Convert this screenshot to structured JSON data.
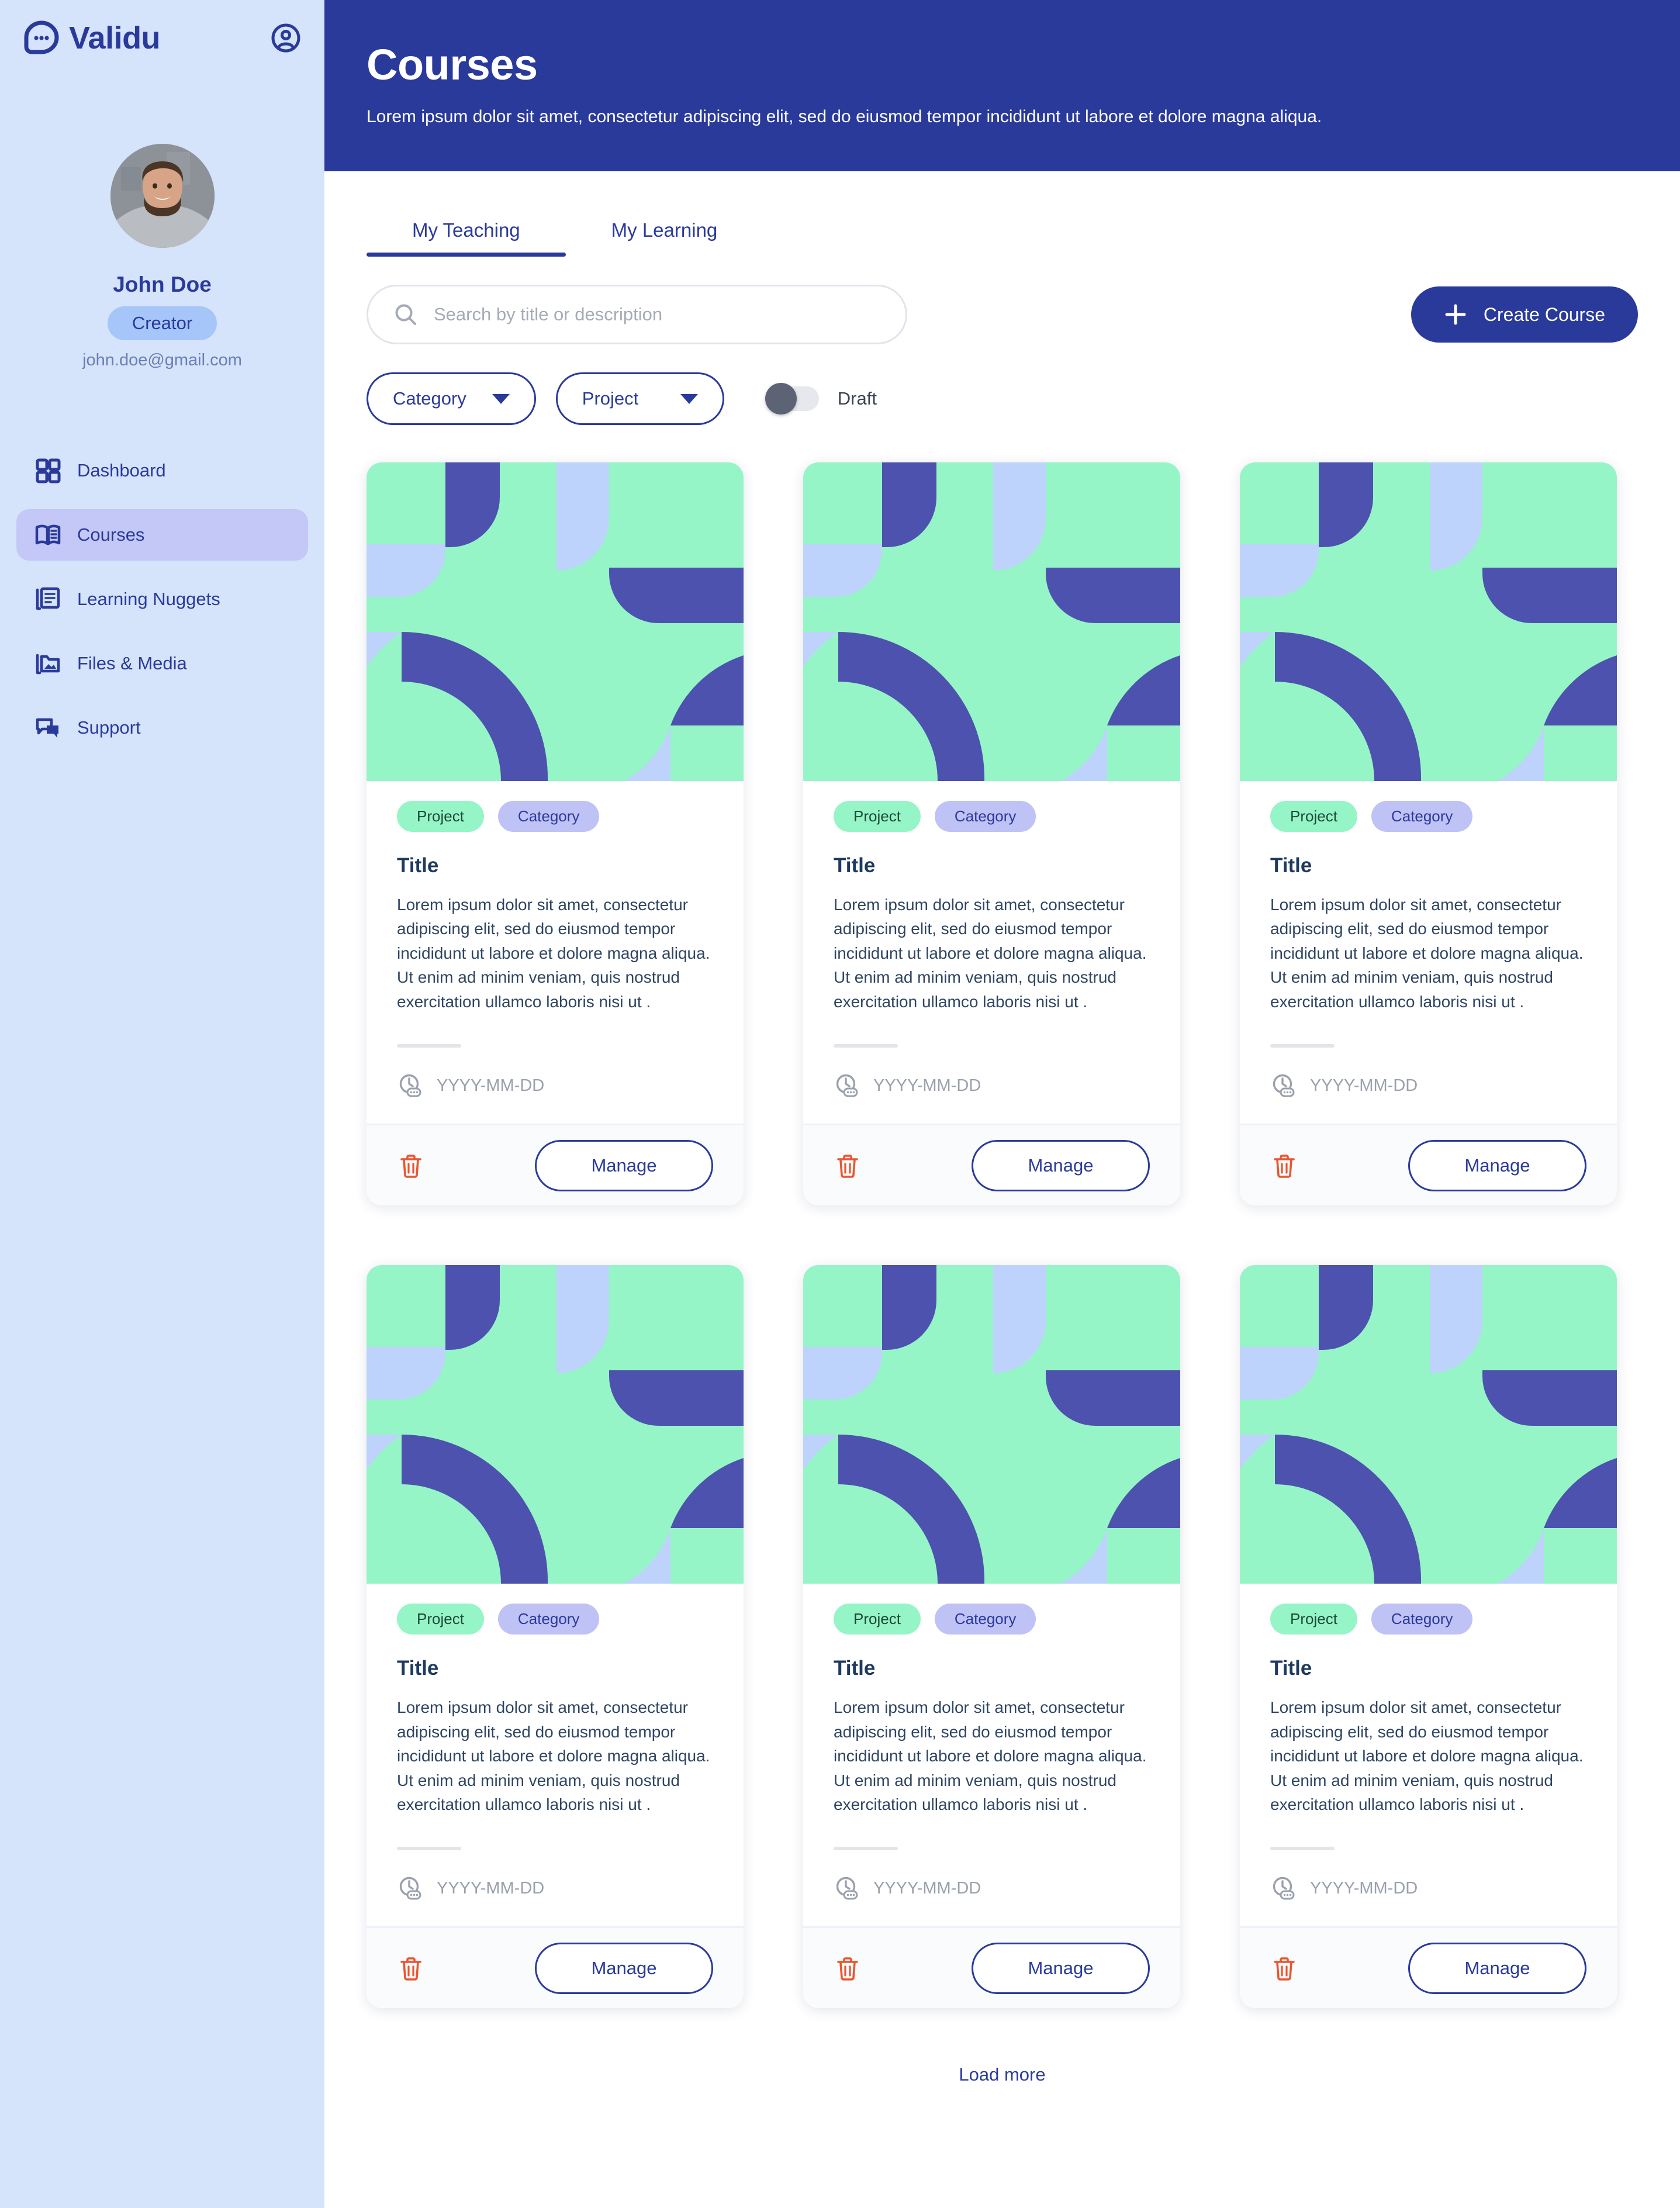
{
  "brand": {
    "name": "Validu",
    "logo_icon": "chat-bubble-dots-icon",
    "account_icon": "account-circle-icon"
  },
  "profile": {
    "name": "John Doe",
    "role": "Creator",
    "email": "john.doe@gmail.com",
    "avatar_alt": "user-avatar-photo"
  },
  "sidebar": {
    "items": [
      {
        "label": "Dashboard",
        "icon": "grid-dashboard-icon",
        "active": false
      },
      {
        "label": "Courses",
        "icon": "open-book-icon",
        "active": true
      },
      {
        "label": "Learning Nuggets",
        "icon": "document-stack-icon",
        "active": false
      },
      {
        "label": "Files & Media",
        "icon": "folder-image-icon",
        "active": false
      },
      {
        "label": "Support",
        "icon": "chat-support-icon",
        "active": false
      }
    ]
  },
  "header": {
    "title": "Courses",
    "subtitle": "Lorem ipsum dolor sit amet, consectetur adipiscing elit, sed do eiusmod tempor incididunt ut labore et dolore magna aliqua."
  },
  "tabs": [
    {
      "label": "My Teaching",
      "active": true
    },
    {
      "label": "My Learning",
      "active": false
    }
  ],
  "search": {
    "placeholder": "Search by title or description",
    "value": "",
    "icon": "search-icon"
  },
  "create_button": {
    "label": "Create Course",
    "icon": "plus-icon"
  },
  "filters": {
    "category": {
      "label": "Category",
      "icon": "chevron-down-icon"
    },
    "project": {
      "label": "Project",
      "icon": "chevron-down-icon"
    },
    "draft_toggle": {
      "label": "Draft",
      "on": false
    }
  },
  "card_template": {
    "pill_project": "Project",
    "pill_category": "Category",
    "title": "Title",
    "description": "Lorem ipsum dolor sit amet, consectetur adipiscing elit, sed do eiusmod tempor incididunt ut labore et dolore magna aliqua. Ut enim ad minim veniam, quis nostrud exercitation ullamco laboris nisi ut .",
    "date": "YYYY-MM-DD",
    "date_icon": "clock-chat-icon",
    "delete_icon": "trash-icon",
    "manage_label": "Manage"
  },
  "cards": [
    {
      "pill_project": "Project",
      "pill_category": "Category",
      "title": "Title",
      "description": "Lorem ipsum dolor sit amet, consectetur adipiscing elit, sed do eiusmod tempor incididunt ut labore et dolore magna aliqua. Ut enim ad minim veniam, quis nostrud exercitation ullamco laboris nisi ut .",
      "date": "YYYY-MM-DD",
      "manage_label": "Manage"
    },
    {
      "pill_project": "Project",
      "pill_category": "Category",
      "title": "Title",
      "description": "Lorem ipsum dolor sit amet, consectetur adipiscing elit, sed do eiusmod tempor incididunt ut labore et dolore magna aliqua. Ut enim ad minim veniam, quis nostrud exercitation ullamco laboris nisi ut .",
      "date": "YYYY-MM-DD",
      "manage_label": "Manage"
    },
    {
      "pill_project": "Project",
      "pill_category": "Category",
      "title": "Title",
      "description": "Lorem ipsum dolor sit amet, consectetur adipiscing elit, sed do eiusmod tempor incididunt ut labore et dolore magna aliqua. Ut enim ad minim veniam, quis nostrud exercitation ullamco laboris nisi ut .",
      "date": "YYYY-MM-DD",
      "manage_label": "Manage"
    },
    {
      "pill_project": "Project",
      "pill_category": "Category",
      "title": "Title",
      "description": "Lorem ipsum dolor sit amet, consectetur adipiscing elit, sed do eiusmod tempor incididunt ut labore et dolore magna aliqua. Ut enim ad minim veniam, quis nostrud exercitation ullamco laboris nisi ut .",
      "date": "YYYY-MM-DD",
      "manage_label": "Manage"
    },
    {
      "pill_project": "Project",
      "pill_category": "Category",
      "title": "Title",
      "description": "Lorem ipsum dolor sit amet, consectetur adipiscing elit, sed do eiusmod tempor incididunt ut labore et dolore magna aliqua. Ut enim ad minim veniam, quis nostrud exercitation ullamco laboris nisi ut .",
      "date": "YYYY-MM-DD",
      "manage_label": "Manage"
    },
    {
      "pill_project": "Project",
      "pill_category": "Category",
      "title": "Title",
      "description": "Lorem ipsum dolor sit amet, consectetur adipiscing elit, sed do eiusmod tempor incididunt ut labore et dolore magna aliqua. Ut enim ad minim veniam, quis nostrud exercitation ullamco laboris nisi ut .",
      "date": "YYYY-MM-DD",
      "manage_label": "Manage"
    }
  ],
  "load_more": {
    "label": "Load more"
  },
  "colors": {
    "brand_blue": "#2a3a9b",
    "sidebar_bg": "#d5e3fb",
    "sidebar_active": "#c3c8f7",
    "role_badge": "#a6c6fa",
    "pill_project": "#96f5c6",
    "pill_category": "#bfc2f5",
    "thumb_mint": "#96f5c6",
    "thumb_indigo": "#4d52ae",
    "thumb_periwinkle": "#bed3fb",
    "delete_red": "#ea5530",
    "toggle_knob": "#5c6374"
  }
}
